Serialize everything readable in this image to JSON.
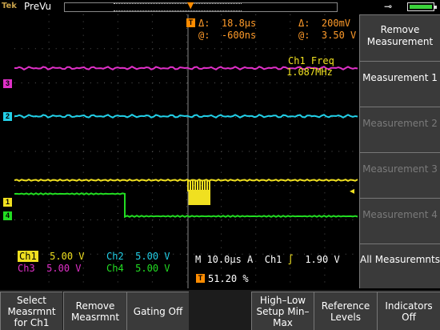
{
  "top": {
    "brand": "Tek",
    "status": "PreVu",
    "plug_icon": "power-plug-icon",
    "battery_icon": "battery-icon"
  },
  "cursor": {
    "delta_t_label": "Δ:",
    "delta_t": "18.8μs",
    "delta_v_label": "Δ:",
    "delta_v": "200mV",
    "at_t_label": "@:",
    "at_t": "-600ns",
    "at_v_label": "@:",
    "at_v": "3.50 V"
  },
  "measurement": {
    "label": "Ch1 Freq",
    "value": "1.087MHz"
  },
  "markers": {
    "ch1": "1",
    "ch2": "2",
    "ch3": "3",
    "ch4": "4",
    "trigger": "T"
  },
  "readouts": {
    "ch1_label": "Ch1",
    "ch1_value": "5.00 V",
    "ch2_label": "Ch2",
    "ch2_value": "5.00 V",
    "ch3_label": "Ch3",
    "ch3_value": "5.00 V",
    "ch4_label": "Ch4",
    "ch4_value": "5.00 V",
    "timebase": "M 10.0μs",
    "acq": "A",
    "trig_source": "Ch1",
    "trig_level": "1.90 V",
    "trig_position": "51.20 %"
  },
  "side_menu": [
    {
      "label": "Remove Measurement",
      "enabled": true
    },
    {
      "label": "Measurement 1",
      "enabled": true
    },
    {
      "label": "Measurement 2",
      "enabled": false
    },
    {
      "label": "Measurement 3",
      "enabled": false
    },
    {
      "label": "Measurement 4",
      "enabled": false
    },
    {
      "label": "All Measuremnts",
      "enabled": true
    }
  ],
  "bottom_menu": [
    {
      "label": "Select Measrmnt for Ch1"
    },
    {
      "label": "Remove Measrmnt"
    },
    {
      "label": "Gating Off"
    },
    {
      "label": "High–Low Setup Min–Max"
    },
    {
      "label": "Reference Levels"
    },
    {
      "label": "Indicators Off"
    }
  ],
  "colors": {
    "ch1": "#f0e020",
    "ch2": "#22d0e8",
    "ch3": "#e030c8",
    "ch4": "#22dd22",
    "trigger": "#ff8c00",
    "cursor_text": "#ff9b2a"
  }
}
